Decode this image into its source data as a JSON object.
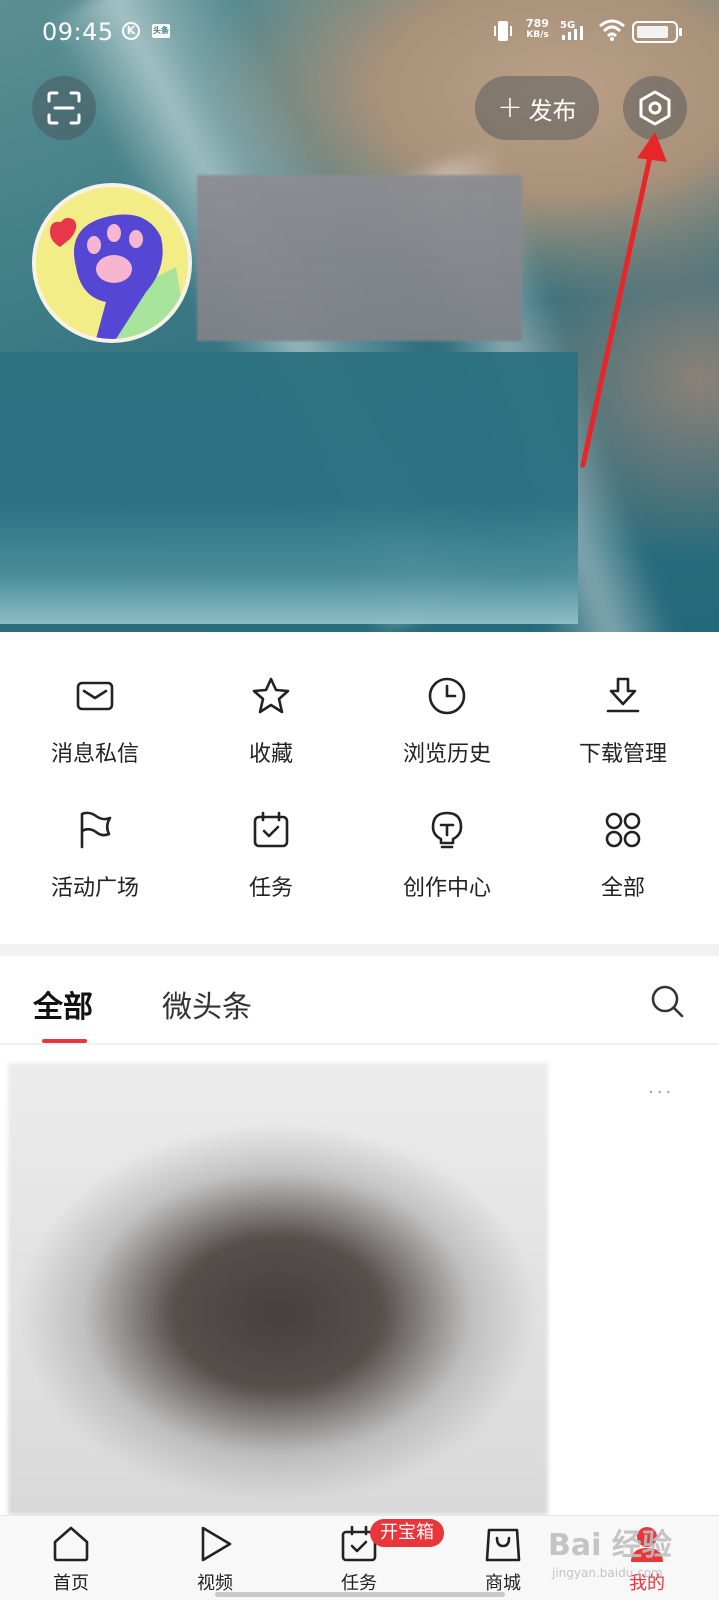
{
  "status_bar": {
    "time": "09:45",
    "k_badge": "K",
    "tt_badge": "头条",
    "speed_value": "789",
    "speed_unit": "KB/s",
    "network": "5G",
    "battery_level": 0.85
  },
  "header": {
    "publish_label": "发布",
    "publish_plus": "+"
  },
  "shortcuts": [
    {
      "label": "消息私信",
      "icon": "message-icon"
    },
    {
      "label": "收藏",
      "icon": "star-icon"
    },
    {
      "label": "浏览历史",
      "icon": "clock-icon"
    },
    {
      "label": "下载管理",
      "icon": "download-icon"
    },
    {
      "label": "活动广场",
      "icon": "flag-icon"
    },
    {
      "label": "任务",
      "icon": "calendar-check-icon"
    },
    {
      "label": "创作中心",
      "icon": "lightbulb-icon"
    },
    {
      "label": "全部",
      "icon": "grid-icon"
    }
  ],
  "tabs": [
    {
      "label": "全部",
      "active": true
    },
    {
      "label": "微头条",
      "active": false
    }
  ],
  "feed": {
    "more_label": "···"
  },
  "bottom_nav": [
    {
      "label": "首页",
      "icon": "home-icon",
      "active": false
    },
    {
      "label": "视频",
      "icon": "play-icon",
      "active": false
    },
    {
      "label": "任务",
      "icon": "task-icon",
      "active": false
    },
    {
      "label": "商城",
      "icon": "shopping-bag-icon",
      "active": false
    },
    {
      "label": "我的",
      "icon": "profile-icon",
      "active": true
    }
  ],
  "nav_badge": "开宝箱",
  "watermark": {
    "main": "Bai 经验",
    "sub": "jingyan.baidu.com"
  },
  "colors": {
    "accent_red": "#e8363a",
    "annotation_arrow": "#e8262a"
  }
}
